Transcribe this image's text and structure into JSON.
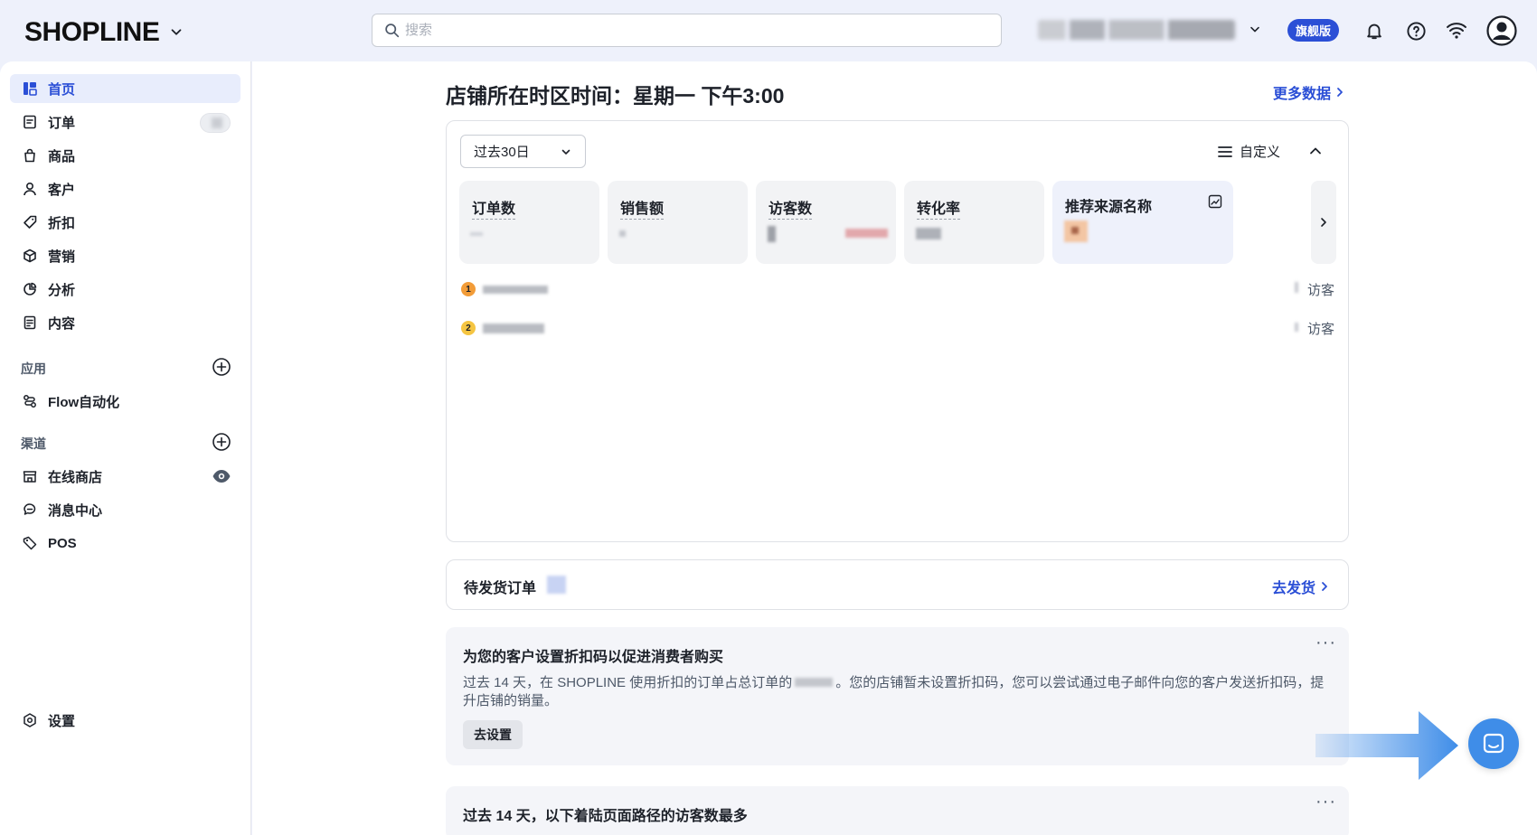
{
  "app": {
    "logo": "SHOPLINE",
    "search_placeholder": "搜索",
    "plan_badge": "旗舰版",
    "accent_color": "#2b4fd6"
  },
  "sidebar": {
    "items": [
      {
        "label": "首页",
        "icon": "dashboard-icon"
      },
      {
        "label": "订单",
        "icon": "order-icon"
      },
      {
        "label": "商品",
        "icon": "bag-icon"
      },
      {
        "label": "客户",
        "icon": "user-icon"
      },
      {
        "label": "折扣",
        "icon": "tag-icon"
      },
      {
        "label": "营销",
        "icon": "cube-icon"
      },
      {
        "label": "分析",
        "icon": "pie-icon"
      },
      {
        "label": "内容",
        "icon": "document-icon"
      }
    ],
    "apps_label": "应用",
    "apps": [
      {
        "label": "Flow自动化",
        "icon": "flow-icon"
      }
    ],
    "channels_label": "渠道",
    "channels": [
      {
        "label": "在线商店",
        "icon": "store-icon"
      },
      {
        "label": "消息中心",
        "icon": "chat-icon"
      },
      {
        "label": "POS",
        "icon": "pos-tag-icon"
      }
    ],
    "settings_label": "设置"
  },
  "main": {
    "title": "店铺所在时区时间：星期一 下午3:00",
    "more_data": "更多数据",
    "period": "过去30日",
    "customize": "自定义",
    "metrics": [
      {
        "label": "订单数"
      },
      {
        "label": "销售额"
      },
      {
        "label": "访客数"
      },
      {
        "label": "转化率"
      },
      {
        "label": "推荐来源名称"
      }
    ],
    "referrers": [
      {
        "rank": "1",
        "unit": "访客"
      },
      {
        "rank": "2",
        "unit": "访客"
      }
    ],
    "pending": {
      "title": "待发货订单",
      "link": "去发货"
    },
    "tip1": {
      "title": "为您的客户设置折扣码以促进消费者购买",
      "body_a": "过去 14 天，在 SHOPLINE 使用折扣的订单占总订单的",
      "body_b": "。您的店铺暂未设置折扣码，您可以尝试通过电子邮件向您的客户发送折扣码，提升店铺的销量。",
      "button": "去设置",
      "menu": "···"
    },
    "tip2": {
      "title": "过去 14 天，以下着陆页面路径的访客数最多",
      "menu": "···"
    }
  }
}
